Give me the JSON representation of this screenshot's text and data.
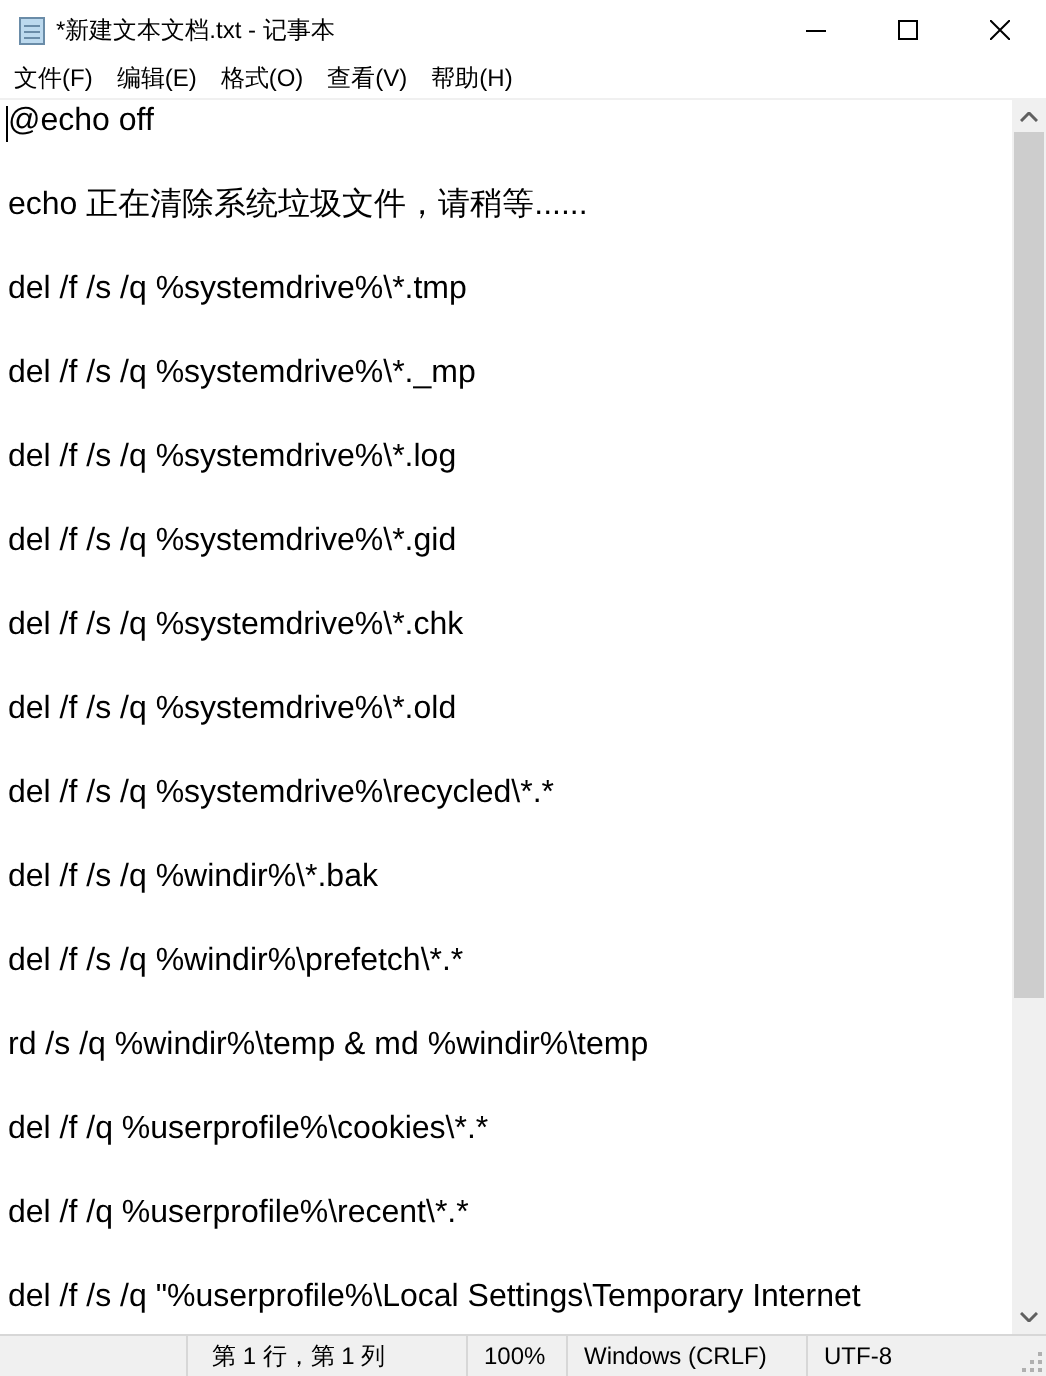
{
  "window": {
    "title": "*新建文本文档.txt - 记事本"
  },
  "menu": [
    "文件(F)",
    "编辑(E)",
    "格式(O)",
    "查看(V)",
    "帮助(H)"
  ],
  "editor": {
    "lines": [
      "@echo off",
      "echo 正在清除系统垃圾文件，请稍等......",
      "del /f /s /q %systemdrive%\\*.tmp",
      "del /f /s /q %systemdrive%\\*._mp",
      "del /f /s /q %systemdrive%\\*.log",
      "del /f /s /q %systemdrive%\\*.gid",
      "del /f /s /q %systemdrive%\\*.chk",
      "del /f /s /q %systemdrive%\\*.old",
      "del /f /s /q %systemdrive%\\recycled\\*.*",
      "del /f /s /q %windir%\\*.bak",
      "del /f /s /q %windir%\\prefetch\\*.*",
      "rd /s /q %windir%\\temp & md %windir%\\temp",
      "del /f /q %userprofile%\\cookies\\*.*",
      "del /f /q %userprofile%\\recent\\*.*",
      "del /f /s /q \"%userprofile%\\Local Settings\\Temporary Internet"
    ]
  },
  "status_bar": {
    "position": "第 1 行，第 1 列",
    "zoom": "100%",
    "line_ending": "Windows (CRLF)",
    "encoding": "UTF-8"
  }
}
